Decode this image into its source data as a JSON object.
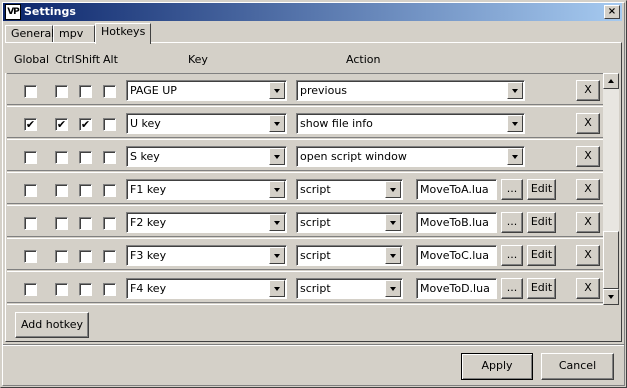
{
  "window": {
    "title": "Settings",
    "icon_text": "VP",
    "close_glyph": "×"
  },
  "tabs": [
    {
      "label": "General",
      "active": false
    },
    {
      "label": "mpv",
      "active": false
    },
    {
      "label": "Hotkeys",
      "active": true
    }
  ],
  "columns": {
    "global": "Global",
    "ctrl": "Ctrl",
    "shift": "Shift",
    "alt": "Alt",
    "key": "Key",
    "action": "Action"
  },
  "rows": [
    {
      "global": false,
      "ctrl": false,
      "shift": false,
      "alt": false,
      "key": "PAGE UP",
      "action": "previous",
      "script": "",
      "browse": "",
      "edit": "",
      "remove": "X"
    },
    {
      "global": true,
      "ctrl": true,
      "shift": true,
      "alt": false,
      "key": "U key",
      "action": "show file info",
      "script": "",
      "browse": "",
      "edit": "",
      "remove": "X"
    },
    {
      "global": false,
      "ctrl": false,
      "shift": false,
      "alt": false,
      "key": "S key",
      "action": "open script window",
      "script": "",
      "browse": "",
      "edit": "",
      "remove": "X"
    },
    {
      "global": false,
      "ctrl": false,
      "shift": false,
      "alt": false,
      "key": "F1 key",
      "action": "script",
      "script": "MoveToA.lua",
      "browse": "...",
      "edit": "Edit",
      "remove": "X"
    },
    {
      "global": false,
      "ctrl": false,
      "shift": false,
      "alt": false,
      "key": "F2 key",
      "action": "script",
      "script": "MoveToB.lua",
      "browse": "...",
      "edit": "Edit",
      "remove": "X"
    },
    {
      "global": false,
      "ctrl": false,
      "shift": false,
      "alt": false,
      "key": "F3 key",
      "action": "script",
      "script": "MoveToC.lua",
      "browse": "...",
      "edit": "Edit",
      "remove": "X"
    },
    {
      "global": false,
      "ctrl": false,
      "shift": false,
      "alt": false,
      "key": "F4 key",
      "action": "script",
      "script": "MoveToD.lua",
      "browse": "...",
      "edit": "Edit",
      "remove": "X"
    }
  ],
  "add_hotkey": "Add hotkey",
  "footer": {
    "apply": "Apply",
    "cancel": "Cancel"
  },
  "check_glyph": "✔"
}
